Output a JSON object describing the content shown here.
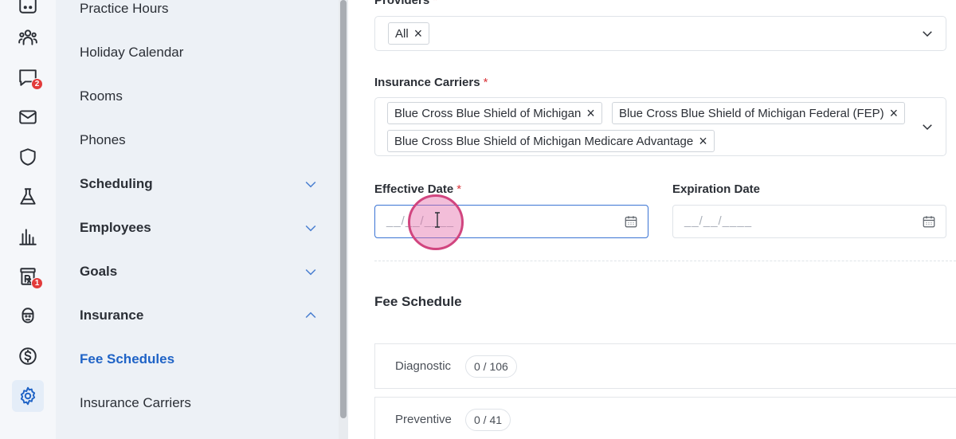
{
  "sidebar": {
    "items": [
      {
        "label": "Practice Hours",
        "type": "link"
      },
      {
        "label": "Holiday Calendar",
        "type": "link"
      },
      {
        "label": "Rooms",
        "type": "link"
      },
      {
        "label": "Phones",
        "type": "link"
      },
      {
        "label": "Scheduling",
        "type": "section",
        "expanded": false
      },
      {
        "label": "Employees",
        "type": "section",
        "expanded": false
      },
      {
        "label": "Goals",
        "type": "section",
        "expanded": false
      },
      {
        "label": "Insurance",
        "type": "section",
        "expanded": true
      },
      {
        "label": "Fee Schedules",
        "type": "link",
        "selected": true
      },
      {
        "label": "Insurance Carriers",
        "type": "link"
      }
    ]
  },
  "rail": {
    "icons": [
      {
        "name": "calendar-icon"
      },
      {
        "name": "patients-icon"
      },
      {
        "name": "chat-icon",
        "badge": "2"
      },
      {
        "name": "mail-icon"
      },
      {
        "name": "shield-icon"
      },
      {
        "name": "lab-flask-icon"
      },
      {
        "name": "reports-chart-icon"
      },
      {
        "name": "prescription-icon",
        "badge": "1"
      },
      {
        "name": "dentist-icon"
      },
      {
        "name": "billing-dollar-icon"
      },
      {
        "name": "settings-gear-icon",
        "active": true
      }
    ]
  },
  "form": {
    "providers_label": "Providers",
    "providers_chip": "All",
    "carriers_label": "Insurance Carriers",
    "carriers_chips": [
      "Blue Cross Blue Shield of Michigan",
      "Blue Cross Blue Shield of Michigan Federal (FEP)",
      "Blue Cross Blue Shield of Michigan Medicare Advantage"
    ],
    "required_mark": "*",
    "effective_date_label": "Effective Date",
    "effective_date_placeholder": "__/__/____",
    "expiration_date_label": "Expiration Date",
    "expiration_date_placeholder": "__/__/____"
  },
  "fee_schedule": {
    "heading": "Fee Schedule",
    "categories": [
      {
        "name": "Diagnostic",
        "count": "0 / 106"
      },
      {
        "name": "Preventive",
        "count": "0 / 41"
      }
    ]
  },
  "colors": {
    "accent": "#1f63c6",
    "badge": "#e23b3b",
    "required": "#d9343a"
  }
}
